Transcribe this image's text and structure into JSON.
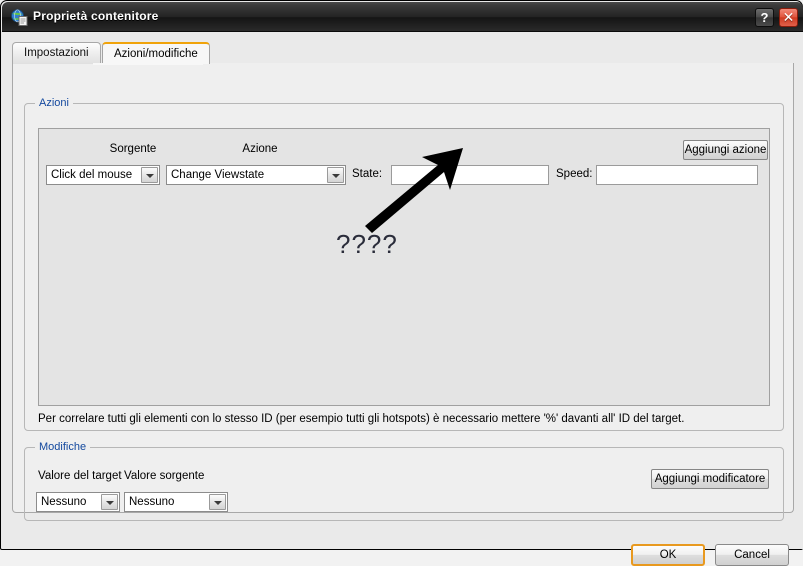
{
  "window": {
    "title": "Proprietà contenitore",
    "icon": "globe-document-icon",
    "help_button": "?",
    "close_button": "✕",
    "accent_color": "#f0a30a",
    "titlebar_color": "#232323",
    "close_button_color": "#cf3a21"
  },
  "tabs": [
    {
      "label": "Impostazioni",
      "active": false
    },
    {
      "label": "Azioni/modifiche",
      "active": true
    }
  ],
  "azioni": {
    "group_title": "Azioni",
    "columns": {
      "sorgente": "Sorgente",
      "azione": "Azione"
    },
    "row": {
      "sorgente_value": "Click del mouse",
      "azione_value": "Change Viewstate",
      "state_label": "State:",
      "state_value": "",
      "state_placeholder": "",
      "speed_label": "Speed:",
      "speed_value": "",
      "speed_placeholder": ""
    },
    "add_action_button": "Aggiungi azione",
    "help_text": "Per correlare tutti gli elementi con lo stesso ID (per esempio tutti gli hotspots) è necessario mettere '%' davanti all' ID del target."
  },
  "modifiche": {
    "group_title": "Modifiche",
    "valore_target_label": "Valore del target",
    "valore_sorgente_label": "Valore sorgente",
    "valore_target_value": "Nessuno",
    "valore_sorgente_value": "Nessuno",
    "add_modifier_button": "Aggiungi modificatore"
  },
  "annotation": {
    "question_marks": "????",
    "arrow": "arrow-pointing-to-state-field",
    "color": "#000000"
  },
  "footer": {
    "ok_button": "OK",
    "cancel_button": "Cancel"
  }
}
